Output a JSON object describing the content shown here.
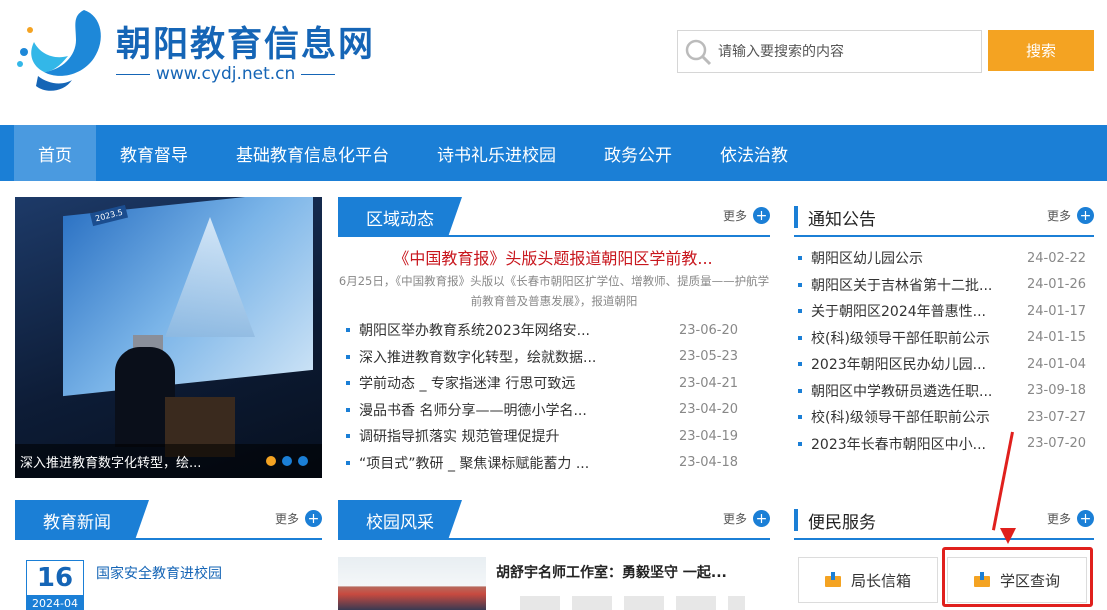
{
  "header": {
    "site_title": "朝阳教育信息网",
    "site_url": "www.cydj.net.cn",
    "search_placeholder": "请输入要搜索的内容",
    "search_button": "搜索"
  },
  "nav": {
    "items": [
      "首页",
      "教育督导",
      "基础教育信息化平台",
      "诗书礼乐进校园",
      "政务公开",
      "依法治教"
    ],
    "active": "首页"
  },
  "banner": {
    "caption": "深入推进教育数字化转型，绘...",
    "tag": "2023.5"
  },
  "regional": {
    "title": "区域动态",
    "more": "更多",
    "headline": "《中国教育报》头版头题报道朝阳区学前教...",
    "summary": "6月25日，《中国教育报》头版以《长春市朝阳区扩学位、增教师、提质量——护航学前教育普及普惠发展》，报道朝阳",
    "items": [
      {
        "title": "朝阳区举办教育系统2023年网络安...",
        "date": "23-06-20"
      },
      {
        "title": "深入推进教育数字化转型，绘就数据...",
        "date": "23-05-23"
      },
      {
        "title": "学前动态 _ 专家指迷津 行思可致远",
        "date": "23-04-21"
      },
      {
        "title": "漫品书香 名师分享——明德小学名...",
        "date": "23-04-20"
      },
      {
        "title": "调研指导抓落实 规范管理促提升",
        "date": "23-04-19"
      },
      {
        "title": "“项目式”教研 _ 聚焦课标赋能蓄力 ...",
        "date": "23-04-18"
      }
    ]
  },
  "notice": {
    "title": "通知公告",
    "more": "更多",
    "items": [
      {
        "title": "朝阳区幼儿园公示",
        "date": "24-02-22"
      },
      {
        "title": "朝阳区关于吉林省第十二批...",
        "date": "24-01-26"
      },
      {
        "title": "关于朝阳区2024年普惠性...",
        "date": "24-01-17"
      },
      {
        "title": "校(科)级领导干部任职前公示",
        "date": "24-01-15"
      },
      {
        "title": "2023年朝阳区民办幼儿园...",
        "date": "24-01-04"
      },
      {
        "title": "朝阳区中学教研员遴选任职...",
        "date": "23-09-18"
      },
      {
        "title": "校(科)级领导干部任职前公示",
        "date": "23-07-27"
      },
      {
        "title": "2023年长春市朝阳区中小...",
        "date": "23-07-20"
      }
    ]
  },
  "news": {
    "title": "教育新闻",
    "more": "更多",
    "first": {
      "day": "16",
      "ym": "2024-04",
      "title": "国家安全教育进校园"
    }
  },
  "campus": {
    "title": "校园风采",
    "more": "更多",
    "first_title": "胡舒宇名师工作室：勇毅坚守 一起..."
  },
  "service": {
    "title": "便民服务",
    "more": "更多",
    "buttons": [
      "局长信箱",
      "学区查询"
    ]
  },
  "colors": {
    "primary": "#1b7fd6",
    "accent": "#f4a322",
    "headline_red": "#c8161d",
    "annotation_red": "#e0201d"
  }
}
